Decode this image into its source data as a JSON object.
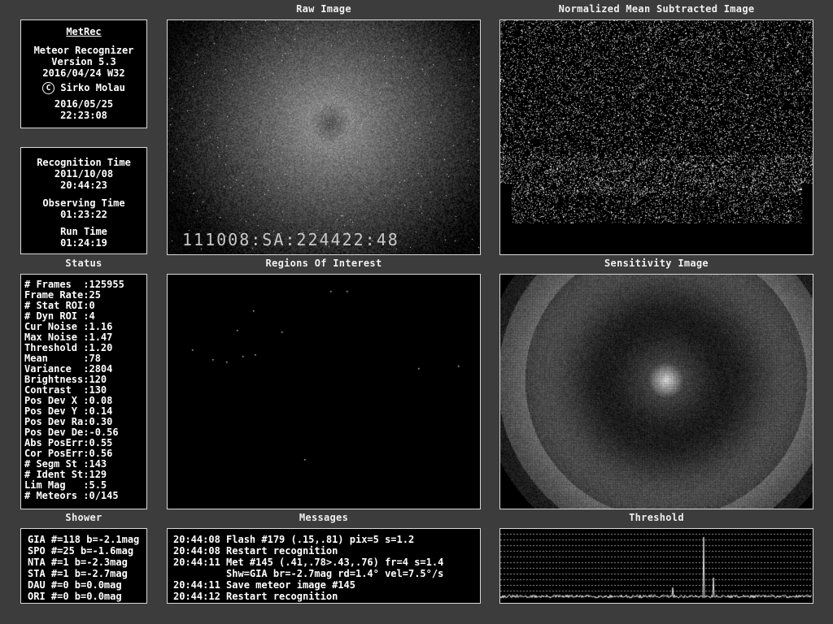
{
  "panels": {
    "raw_title": "Raw Image",
    "normalized_title": "Normalized Mean Subtracted Image",
    "status_title": "Status",
    "roi_title": "Regions Of Interest",
    "sensitivity_title": "Sensitivity Image",
    "shower_title": "Shower",
    "messages_title": "Messages",
    "threshold_title": "Threshold"
  },
  "app": {
    "name": "MetRec",
    "line1": "Meteor Recognizer",
    "line2": "Version 5.3",
    "line3": "2016/04/24 W32",
    "copyright_symbol": "C",
    "author": "Sirko Molau",
    "date": "2016/05/25",
    "time": "22:23:08"
  },
  "timing": {
    "recognition_label": "Recognition Time",
    "recognition_date": "2011/10/08",
    "recognition_time": "20:44:23",
    "observing_label": "Observing Time",
    "observing_time": "01:23:22",
    "run_label": "Run Time",
    "run_time": "01:24:19"
  },
  "raw_image": {
    "timestamp": "111008:SA:224422:48"
  },
  "status": [
    {
      "label": "# Frames  ",
      "value": "125955"
    },
    {
      "label": "Frame Rate",
      "value": "25"
    },
    {
      "label": "# Stat ROI",
      "value": "0"
    },
    {
      "label": "# Dyn ROI ",
      "value": "4"
    },
    {
      "label": "Cur Noise ",
      "value": "1.16"
    },
    {
      "label": "Max Noise ",
      "value": "1.47"
    },
    {
      "label": "Threshold ",
      "value": "1.20"
    },
    {
      "label": "Mean      ",
      "value": "78"
    },
    {
      "label": "Variance  ",
      "value": "2804"
    },
    {
      "label": "Brightness",
      "value": "120"
    },
    {
      "label": "Contrast  ",
      "value": "130"
    },
    {
      "label": "Pos Dev X ",
      "value": "0.08"
    },
    {
      "label": "Pos Dev Y ",
      "value": "0.14"
    },
    {
      "label": "Pos Dev Ra",
      "value": "0.30"
    },
    {
      "label": "Pos Dev De",
      "value": "-0.56"
    },
    {
      "label": "Abs PosErr",
      "value": "0.55"
    },
    {
      "label": "Cor PosErr",
      "value": "0.56"
    },
    {
      "label": "# Segm St ",
      "value": "143"
    },
    {
      "label": "# Ident St",
      "value": "129"
    },
    {
      "label": "Lim Mag   ",
      "value": "5.5"
    },
    {
      "label": "# Meteors ",
      "value": "0/145"
    }
  ],
  "showers": [
    "GIA #=118 b=-2.1mag",
    "SPO #=25 b=-1.6mag",
    "NTA #=1 b=-2.3mag",
    "STA #=1 b=-2.7mag",
    "DAU #=0 b=0.0mag",
    "ORI #=0 b=0.0mag"
  ],
  "messages": [
    "20:44:08 Flash #179 (.15,.81) pix=5 s=1.2",
    "20:44:08 Restart recognition",
    "20:44:11 Met #145 (.41,.78>.43,.76) fr=4 s=1.4",
    "         Shw=GIA br=-2.7mag rd=1.4° vel=7.5°/s",
    "20:44:11 Save meteor image #145",
    "20:44:12 Restart recognition"
  ]
}
